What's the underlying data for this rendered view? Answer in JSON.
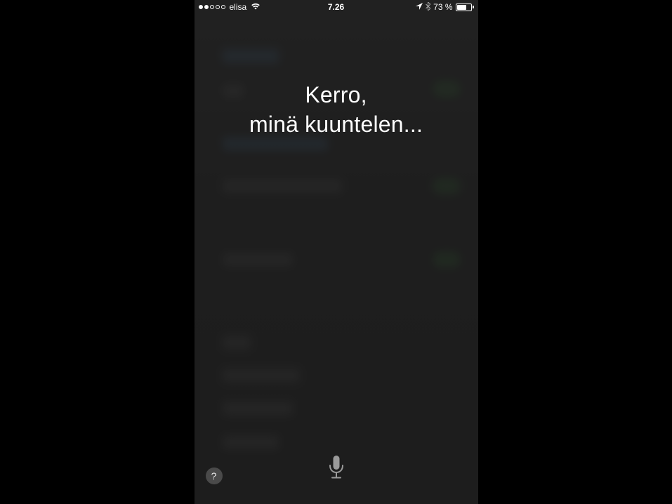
{
  "status_bar": {
    "carrier": "elisa",
    "signal_strength": 2,
    "time": "7.26",
    "battery_percent": "73 %",
    "battery_level": 73,
    "location_active": true,
    "bluetooth_active": true,
    "wifi_active": true
  },
  "siri": {
    "prompt_line1": "Kerro,",
    "prompt_line2": "minä kuuntelen...",
    "help_label": "?",
    "mic_label": "mic"
  }
}
